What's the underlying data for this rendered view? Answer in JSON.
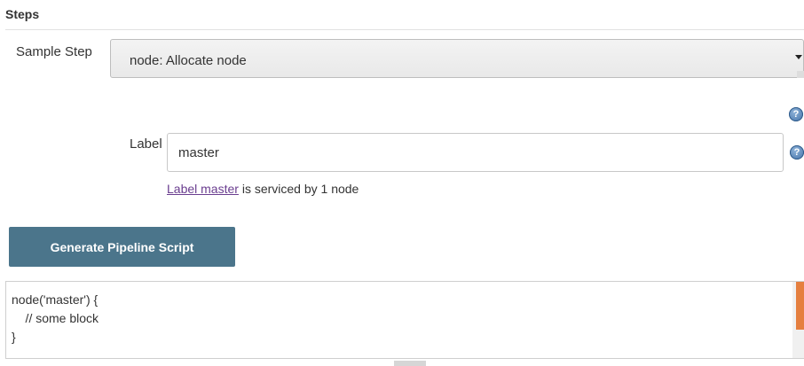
{
  "section": {
    "title": "Steps"
  },
  "sample_step": {
    "label": "Sample Step",
    "selected": "node: Allocate node"
  },
  "label_field": {
    "label": "Label",
    "value": "master"
  },
  "label_note": {
    "link_text": "Label master",
    "rest_text": " is serviced by 1 node"
  },
  "help": {
    "glyph": "?"
  },
  "generate_button": {
    "label": "Generate Pipeline Script"
  },
  "script": {
    "lines": [
      "node('master') {",
      "    // some block",
      "}"
    ]
  },
  "colors": {
    "button_bg": "#4b758b",
    "link": "#6a3d8f",
    "scroll_accent": "#e57f3f",
    "help_icon": "#3f6fa6"
  },
  "icons": {
    "help": "help-icon",
    "dropdown": "chevron-down-icon"
  }
}
